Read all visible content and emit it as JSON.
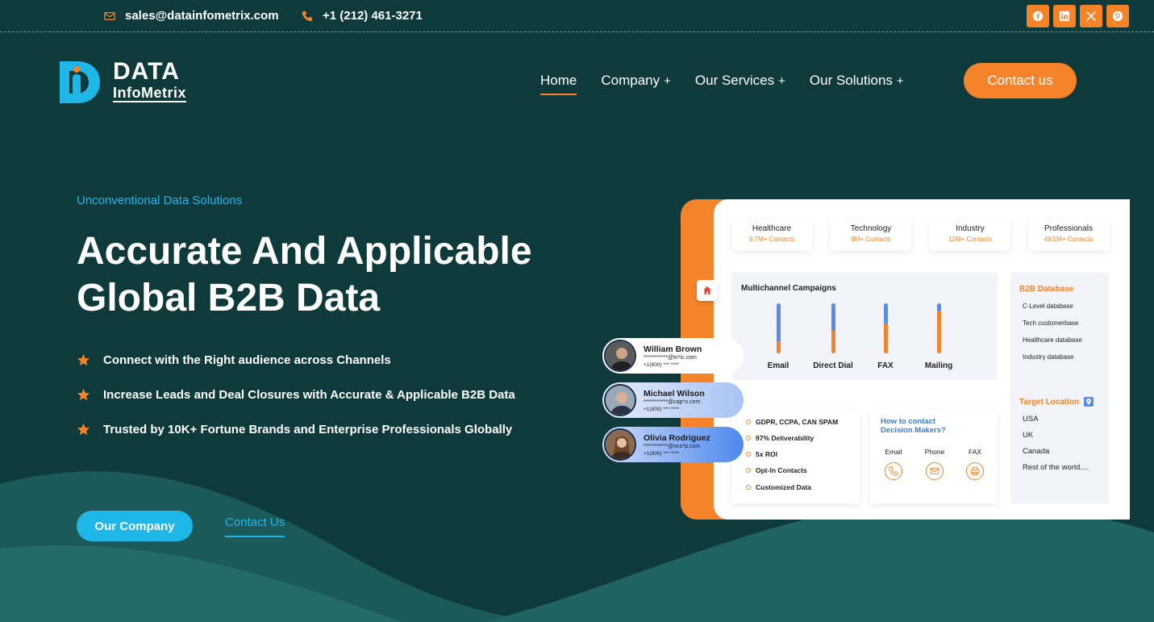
{
  "topbar": {
    "email": "sales@datainfometrix.com",
    "phone": "+1 (212) 461-3271",
    "socials": [
      "facebook-icon",
      "linkedin-icon",
      "x-icon",
      "pinterest-icon"
    ],
    "accent": "#f5832a"
  },
  "logo": {
    "line1": "DATA",
    "line2": "InfoMetrix"
  },
  "nav": {
    "items": [
      {
        "label": "Home"
      },
      {
        "label": "Company",
        "suffix": "+"
      },
      {
        "label": "Our Services",
        "suffix": "+"
      },
      {
        "label": "Our Solutions",
        "suffix": "+"
      }
    ],
    "cta": "Contact us"
  },
  "hero": {
    "eyebrow": "Unconventional Data Solutions",
    "headline": "Accurate And Applicable Global B2B Data",
    "bullets": [
      "Connect with the Right audience across Channels",
      "Increase Leads and Deal Closures with Accurate & Applicable B2B Data",
      "Trusted by 10K+ Fortune Brands and Enterprise Professionals Globally"
    ],
    "primary_button": "Our Company",
    "secondary_link": "Contact Us"
  },
  "dashboard": {
    "stats": [
      {
        "title": "Healthcare",
        "sub": "9.7M+ Contacts"
      },
      {
        "title": "Technology",
        "sub": "9M+ Contacts"
      },
      {
        "title": "Industry",
        "sub": "12M+ Contacts"
      },
      {
        "title": "Professionals",
        "sub": "49.5M+ Contacts"
      }
    ],
    "campaign": {
      "title": "Multichannel Campaigns",
      "bars": [
        {
          "label": "Email",
          "orange": 0.25
        },
        {
          "label": "Direct Dial",
          "orange": 0.45
        },
        {
          "label": "FAX",
          "orange": 0.6
        },
        {
          "label": "Mailing",
          "orange": 0.85
        }
      ]
    },
    "b2b": {
      "title": "B2B Database",
      "items": [
        "C-Level database",
        "Tech customerbase",
        "Healthcare database",
        "Industry database"
      ],
      "location_title": "Target Location",
      "locations": [
        "USA",
        "UK",
        "Canada",
        "Rest of the world...."
      ]
    },
    "features": [
      "GDPR, CCPA, CAN SPAM",
      "97% Deliverability",
      "5x ROI",
      "Opt-In Contacts",
      "Customized Data"
    ],
    "howto": {
      "title": "How to contact Decision Makers?",
      "channels": [
        {
          "label": "Email",
          "icon": "phone-icon"
        },
        {
          "label": "Phone",
          "icon": "mail-icon"
        },
        {
          "label": "FAX",
          "icon": "printer-icon"
        }
      ]
    }
  },
  "people": [
    {
      "name": "William Brown",
      "email": "***********@tn*ic.com",
      "phone": "+1(800) *** ****"
    },
    {
      "name": "Michael Wilson",
      "email": "***********@cap*o.com",
      "phone": "+1(800) *** ****"
    },
    {
      "name": "Olivia Rodriguez",
      "email": "***********@nco*p.com",
      "phone": "+1(800) *** ****"
    }
  ]
}
